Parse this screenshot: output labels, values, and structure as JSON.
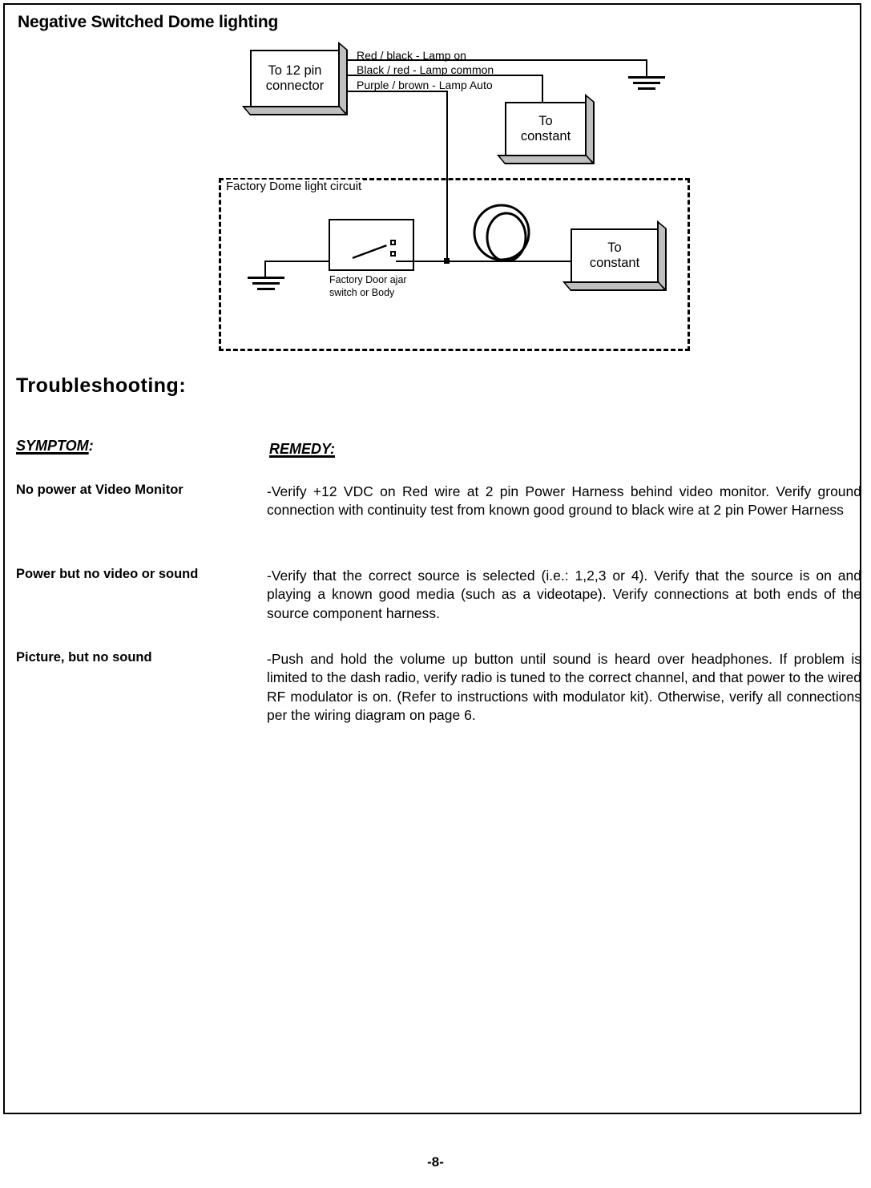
{
  "page": {
    "title": "Negative Switched Dome lighting",
    "page_number": "-8-"
  },
  "diagram": {
    "connector_box": {
      "line1": "To 12 pin",
      "line2": "connector"
    },
    "wires": [
      {
        "label": "Red / black - Lamp on"
      },
      {
        "label": "Black / red - Lamp common"
      },
      {
        "label": "Purple / brown - Lamp Auto"
      }
    ],
    "constant_box_top": {
      "line1": "To",
      "line2": "constant"
    },
    "constant_box_bottom": {
      "line1": "To",
      "line2": "constant"
    },
    "factory_circuit_label": "Factory Dome light circuit",
    "switch_label_line1": "Factory Door ajar",
    "switch_label_line2": "switch or Body",
    "symbols": {
      "ground_top": "ground-symbol",
      "ground_bottom": "ground-symbol",
      "lamp": "lamp-bulb-symbol",
      "switch": "spst-switch-symbol",
      "junction": "wire-junction-dot"
    }
  },
  "troubleshooting": {
    "title": "Troubleshooting:",
    "header_symptom": "SYMPTOM",
    "header_symptom_colon": ":",
    "header_remedy": "REMEDY:",
    "rows": [
      {
        "symptom": "No power at Video Monitor",
        "remedy": "-Verify +12 VDC on Red wire at 2 pin Power Harness behind video monitor.  Verify  ground connection with continuity test from known good ground to black wire at 2 pin Power Harness"
      },
      {
        "symptom": "Power but no video or sound",
        "remedy": "-Verify that the correct source is selected (i.e.: 1,2,3 or 4).  Verify that the source is on and playing a known good media (such as a videotape).  Verify connections at both ends of the source component harness."
      },
      {
        "symptom": "Picture, but no sound",
        "remedy": "-Push and hold the volume up button until sound is heard over headphones.  If problem is limited to the dash radio, verify radio is tuned to the correct channel, and that power to the wired RF modulator is on.  (Refer to instructions with modulator kit).  Otherwise, verify all connections per the wiring diagram on page 6."
      }
    ]
  }
}
